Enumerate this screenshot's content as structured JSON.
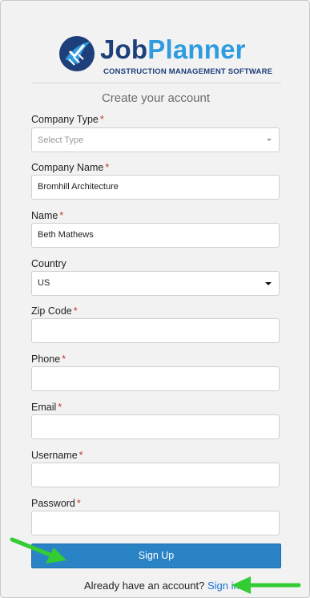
{
  "brand": {
    "name_part1": "Job",
    "name_part2": "Planner",
    "tagline": "CONSTRUCTION MANAGEMENT SOFTWARE",
    "colors": {
      "dark": "#1d3f7a",
      "light": "#2f9be0"
    }
  },
  "form": {
    "title": "Create your account",
    "required_mark": "*",
    "fields": {
      "company_type": {
        "label": "Company Type",
        "placeholder": "Select Type"
      },
      "company_name": {
        "label": "Company Name",
        "value": "Bromhill Architecture"
      },
      "name": {
        "label": "Name",
        "value": "Beth Mathews"
      },
      "country": {
        "label": "Country",
        "value": "US"
      },
      "zip": {
        "label": "Zip Code",
        "value": ""
      },
      "phone": {
        "label": "Phone",
        "value": ""
      },
      "email": {
        "label": "Email",
        "value": ""
      },
      "username": {
        "label": "Username",
        "value": ""
      },
      "password": {
        "label": "Password",
        "value": ""
      }
    },
    "submit_label": "Sign Up",
    "signin_prompt": "Already have an account?",
    "signin_link": "Sign in"
  },
  "annotations": {
    "arrow_color": "#33cc33"
  }
}
